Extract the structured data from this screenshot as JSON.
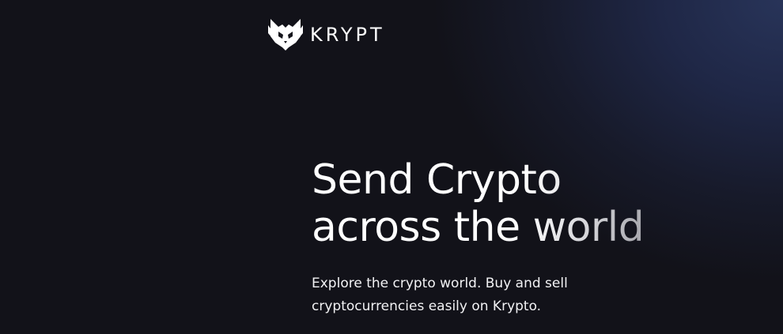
{
  "brand": {
    "logo_icon": "fox-mask-icon",
    "name": "KRYPT"
  },
  "hero": {
    "title_line_1": "Send Crypto",
    "title_line_2": "across the world",
    "subtitle": "Explore the crypto world. Buy and sell cryptocurrencies easily on Krypto."
  },
  "colors": {
    "background_dark": "#121219",
    "background_accent": "#283459",
    "text": "#ffffff"
  }
}
